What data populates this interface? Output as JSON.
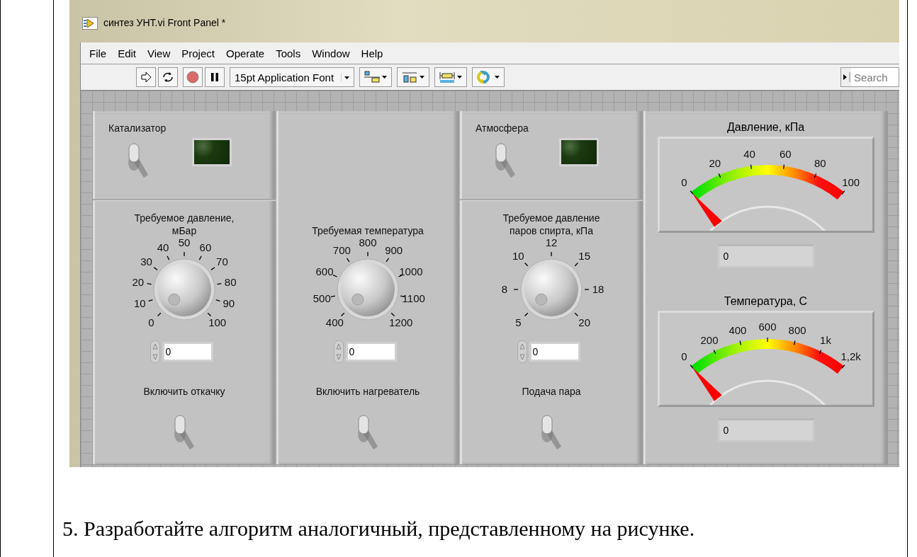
{
  "window": {
    "title": "синтез УНТ.vi Front Panel *"
  },
  "menu": [
    "File",
    "Edit",
    "View",
    "Project",
    "Operate",
    "Tools",
    "Window",
    "Help"
  ],
  "toolbar": {
    "font": "15pt Application Font",
    "search_placeholder": "Search"
  },
  "panels": [
    {
      "indicator": {
        "label": "Катализатор",
        "switch_on": false,
        "led_on": false
      },
      "knob": {
        "label": "Требуемое давление,\nмБар",
        "ticks": [
          "0",
          "10",
          "20",
          "30",
          "40",
          "50",
          "60",
          "70",
          "80",
          "90",
          "100"
        ],
        "value": "0",
        "switch_label": "Включить откачку",
        "switch_on": false
      }
    },
    {
      "knob": {
        "label": "Требуемая температура",
        "ticks": [
          "400",
          "500",
          "600",
          "700",
          "800",
          "900",
          "1000",
          "1100",
          "1200"
        ],
        "value": "0",
        "switch_label": "Включить нагреватель",
        "switch_on": false
      }
    },
    {
      "indicator": {
        "label": "Атмосфера",
        "switch_on": false,
        "led_on": false
      },
      "knob": {
        "label": "Требуемое давление\nпаров спирта, кПа",
        "ticks": [
          "5",
          "8",
          "10",
          "12",
          "15",
          "18",
          "20"
        ],
        "value": "0",
        "switch_label": "Подача пара",
        "switch_on": false
      }
    }
  ],
  "gauges": [
    {
      "label": "Давление, кПа",
      "ticks": [
        "0",
        "20",
        "40",
        "60",
        "80",
        "100"
      ],
      "value": "0"
    },
    {
      "label": "Температура, С",
      "ticks": [
        "0",
        "200",
        "400",
        "600",
        "800",
        "1k",
        "1,2k"
      ],
      "value": "0"
    }
  ],
  "caption": "5. Разработайте алгоритм аналогичный, представленному на рисунке."
}
